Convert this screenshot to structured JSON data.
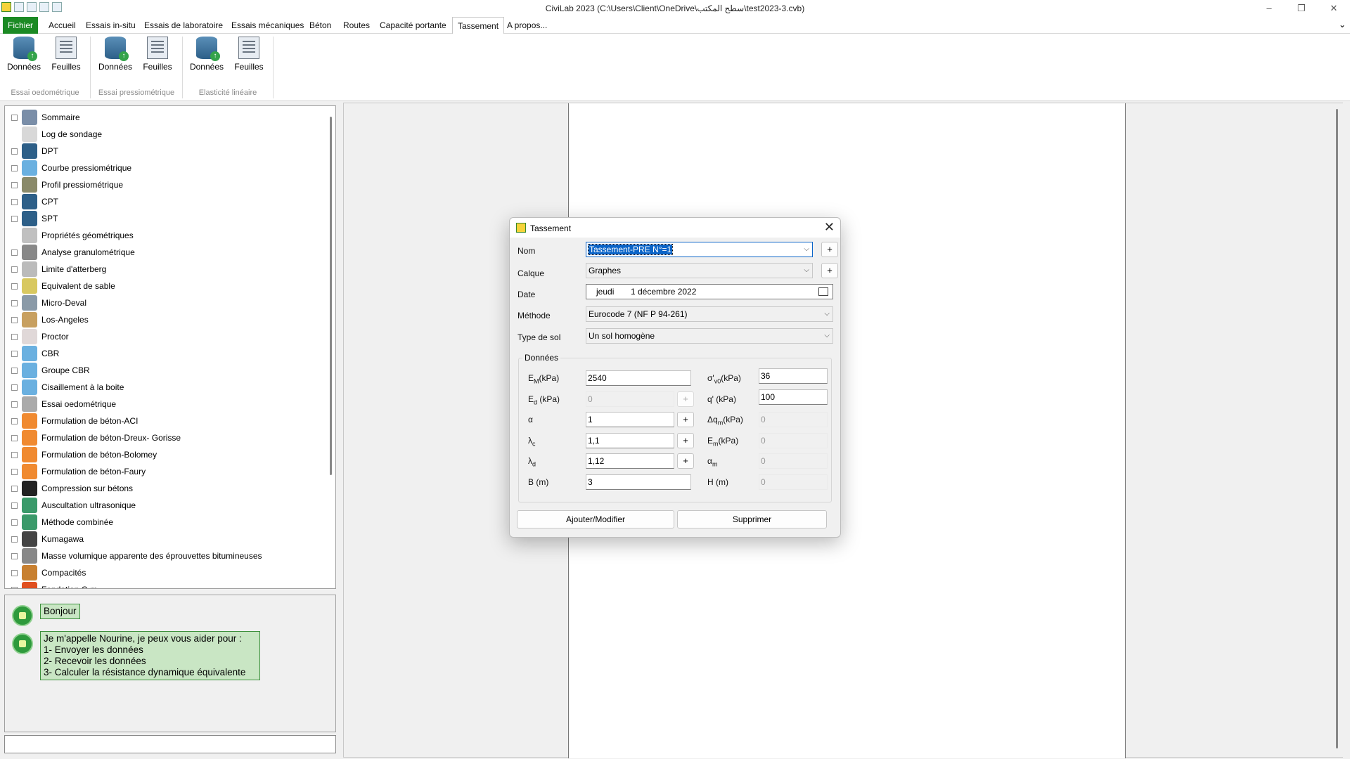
{
  "window": {
    "title": "CiviLab  2023 (C:\\Users\\Client\\OneDrive\\سطح المكتب\\test2023-3.cvb)",
    "controls": [
      "–",
      "❐",
      "✕"
    ]
  },
  "menu": {
    "tabs": [
      "Fichier",
      "Accueil",
      "Essais in-situ",
      "Essais de laboratoire",
      "Essais mécaniques",
      "Béton",
      "Routes",
      "Capacité portante",
      "Tassement",
      "A propos..."
    ],
    "active": "Tassement",
    "collapse": "⌄"
  },
  "ribbon": {
    "buttons": [
      "Données",
      "Feuilles",
      "Données",
      "Feuilles",
      "Données",
      "Feuilles"
    ],
    "groups": [
      "Essai oedométrique",
      "Essai pressiométrique",
      "Elasticité linéaire"
    ]
  },
  "tree": {
    "items": [
      "Sommaire",
      "Log de sondage",
      "DPT",
      "Courbe pressiométrique",
      "Profil pressiométrique",
      "CPT",
      "SPT",
      "Propriétés géométriques",
      "Analyse granulométrique",
      "Limite d'atterberg",
      "Equivalent de sable",
      "Micro-Deval",
      "Los-Angeles",
      "Proctor",
      "CBR",
      "Groupe CBR",
      "Cisaillement à la boite",
      "Essai oedométrique",
      "Formulation de béton-ACI",
      "Formulation de béton-Dreux- Gorisse",
      "Formulation de béton-Bolomey",
      "Formulation de béton-Faury",
      "Compression sur bétons",
      "Auscultation ultrasonique",
      "Méthode combinée",
      "Kumagawa",
      "Masse volumique apparente des éprouvettes bitumineuses",
      "Compacités",
      "Fondation C-m"
    ]
  },
  "assistant": {
    "greeting": "Bonjour",
    "lines": [
      "Je m'appelle Nourine, je peux vous aider pour :",
      "1- Envoyer les données",
      "2- Recevoir les données",
      "3- Calculer la résistance dynamique équivalente"
    ]
  },
  "dialog": {
    "title": "Tassement",
    "labels": {
      "nom": "Nom",
      "calque": "Calque",
      "date": "Date",
      "methode": "Méthode",
      "type_sol": "Type de sol",
      "donnees": "Données"
    },
    "nom_value": "Tassement-PRE N°=1",
    "calque_value": "Graphes",
    "date_day": "jeudi",
    "date_value": "1   décembre  2022",
    "methode_value": "Eurocode 7 (NF P 94-261)",
    "type_sol_value": "Un sol homogène",
    "plus": "+",
    "fields_left": [
      {
        "label": "E",
        "sub": "M",
        "suffix": "(kPa)",
        "value": "2540",
        "enabled": true,
        "plus": false
      },
      {
        "label": "E",
        "sub": "d",
        "suffix": " (kPa)",
        "value": "0",
        "enabled": false,
        "plus": true
      },
      {
        "label": "α",
        "sub": "",
        "suffix": "",
        "value": "1",
        "enabled": true,
        "plus": true
      },
      {
        "label": "λ",
        "sub": "c",
        "suffix": "",
        "value": "1,1",
        "enabled": true,
        "plus": true
      },
      {
        "label": "λ",
        "sub": "d",
        "suffix": "",
        "value": "1,12",
        "enabled": true,
        "plus": true
      },
      {
        "label": "B",
        "sub": "",
        "suffix": "  (m)",
        "value": "3",
        "enabled": true,
        "plus": false
      }
    ],
    "fields_right": [
      {
        "label": "σ'",
        "sub": "v0",
        "suffix": "(kPa)",
        "value": "36",
        "enabled": true
      },
      {
        "label": "q'",
        "sub": "",
        "suffix": "  (kPa)",
        "value": "100",
        "enabled": true
      },
      {
        "label": "Δq",
        "sub": "m",
        "suffix": "(kPa)",
        "value": "0",
        "enabled": false
      },
      {
        "label": "E",
        "sub": "m",
        "suffix": "(kPa)",
        "value": "0",
        "enabled": false
      },
      {
        "label": "α",
        "sub": "m",
        "suffix": "",
        "value": "0",
        "enabled": false
      },
      {
        "label": "H",
        "sub": "",
        "suffix": "  (m)",
        "value": "0",
        "enabled": false
      }
    ],
    "btn_add": "Ajouter/Modifier",
    "btn_delete": "Supprimer",
    "close": "✕"
  }
}
